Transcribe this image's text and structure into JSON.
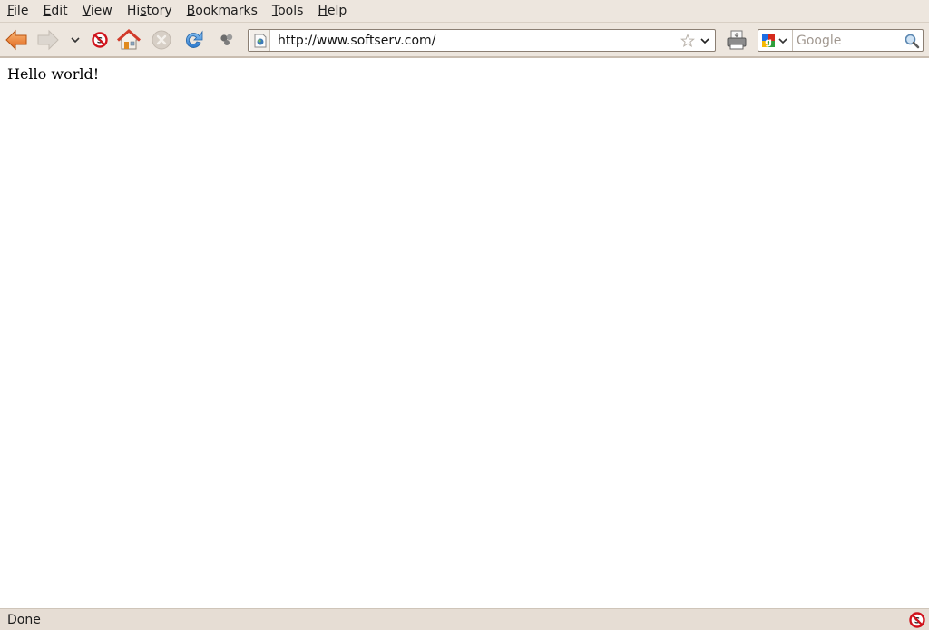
{
  "menubar": {
    "items": [
      {
        "label": "File",
        "mnemonic_index": 0
      },
      {
        "label": "Edit",
        "mnemonic_index": 0
      },
      {
        "label": "View",
        "mnemonic_index": 0
      },
      {
        "label": "History",
        "mnemonic_index": 2
      },
      {
        "label": "Bookmarks",
        "mnemonic_index": 0
      },
      {
        "label": "Tools",
        "mnemonic_index": 0
      },
      {
        "label": "Help",
        "mnemonic_index": 0
      }
    ]
  },
  "toolbar": {
    "buttons": [
      {
        "name": "back",
        "icon": "back-arrow-icon",
        "enabled": true
      },
      {
        "name": "forward",
        "icon": "forward-arrow-icon",
        "enabled": false
      },
      {
        "name": "history-dropdown",
        "icon": "chevron-down-icon",
        "enabled": true
      },
      {
        "name": "noscript",
        "icon": "noscript-icon",
        "enabled": true
      },
      {
        "name": "home",
        "icon": "home-icon",
        "enabled": true
      },
      {
        "name": "stop",
        "icon": "stop-icon",
        "enabled": false
      },
      {
        "name": "reload",
        "icon": "reload-icon",
        "enabled": true
      },
      {
        "name": "extension",
        "icon": "extension-icon",
        "enabled": true
      }
    ],
    "url": "http://www.softserv.com/",
    "print_icon": "print-icon",
    "search": {
      "engine": "Google",
      "placeholder": "Google",
      "value": ""
    }
  },
  "page": {
    "text": "Hello world!"
  },
  "statusbar": {
    "text": "Done",
    "icon": "noscript-icon"
  },
  "colors": {
    "chrome_bg": "#ede6de",
    "status_bg": "#e6ddd4",
    "back_orange": "#f08a2c",
    "reload_blue": "#3c8fe0",
    "noscript_red": "#d0121b"
  }
}
